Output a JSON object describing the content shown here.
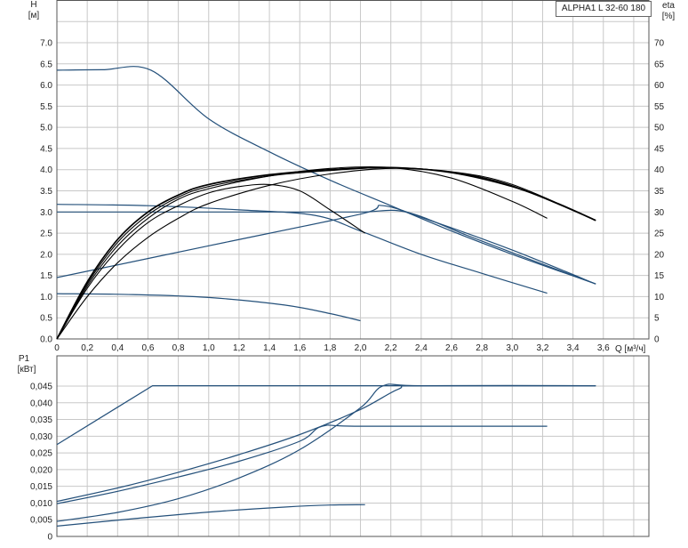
{
  "title": "ALPHA1 L 32-60 180",
  "chart_data": [
    {
      "type": "line",
      "panel": "head-efficiency",
      "xlabel": "Q [м³/ч]",
      "ylabel": "H",
      "ylabel_unit": "[м]",
      "y2label": "eta",
      "y2label_unit": "[%]",
      "xlim": [
        0,
        3.9
      ],
      "ylim": [
        0,
        7.0
      ],
      "y2lim": [
        0,
        70
      ],
      "x_ticks": [
        "0",
        "0,2",
        "0,4",
        "0,6",
        "0,8",
        "1,0",
        "1,2",
        "1,4",
        "1,6",
        "1,8",
        "2,0",
        "2,2",
        "2,4",
        "2,6",
        "2,8",
        "3,0",
        "3,2",
        "3,4",
        "3,6"
      ],
      "y_ticks": [
        "0.0",
        "0.5",
        "1.0",
        "1.5",
        "2.0",
        "2.5",
        "3.0",
        "3.5",
        "4.0",
        "4.5",
        "5.0",
        "5.5",
        "6.0",
        "6.5",
        "7.0"
      ],
      "y2_ticks": [
        "0",
        "5",
        "10",
        "15",
        "20",
        "25",
        "30",
        "35",
        "40",
        "45",
        "50",
        "55",
        "60",
        "65",
        "70"
      ],
      "grid": true,
      "series": [
        {
          "kind": "head",
          "color": "#24507a",
          "x": [
            0,
            0.3,
            0.62,
            1.0,
            1.4,
            1.8,
            2.2,
            2.6,
            3.0,
            3.55
          ],
          "y": [
            6.35,
            6.36,
            6.35,
            5.2,
            4.42,
            3.75,
            3.15,
            2.55,
            2.0,
            1.3
          ]
        },
        {
          "kind": "head",
          "color": "#24507a",
          "x": [
            0,
            0.6,
            1.2,
            1.7,
            2.0,
            2.4,
            2.8,
            3.23
          ],
          "y": [
            3.18,
            3.15,
            3.05,
            2.92,
            2.55,
            2.0,
            1.55,
            1.08
          ]
        },
        {
          "kind": "head",
          "color": "#24507a",
          "x": [
            0,
            0.5,
            1.0,
            1.5,
            2.0,
            2.3,
            2.7,
            3.1,
            3.55
          ],
          "y": [
            3.0,
            3.0,
            3.0,
            3.0,
            3.0,
            3.0,
            2.45,
            1.9,
            1.3
          ]
        },
        {
          "kind": "head",
          "color": "#24507a",
          "x": [
            0,
            1.0,
            2.0,
            2.15,
            2.5,
            3.0,
            3.55
          ],
          "y": [
            1.45,
            2.2,
            2.95,
            3.15,
            2.75,
            2.1,
            1.3
          ]
        },
        {
          "kind": "head",
          "color": "#24507a",
          "x": [
            0,
            0.5,
            1.0,
            1.5,
            1.8,
            2.0
          ],
          "y": [
            1.07,
            1.05,
            0.98,
            0.8,
            0.6,
            0.43
          ]
        },
        {
          "kind": "eta",
          "color": "#000000",
          "x": [
            0,
            0.2,
            0.4,
            0.6,
            0.8,
            1.0,
            1.4,
            1.8,
            2.2,
            2.6,
            3.0,
            3.3,
            3.55
          ],
          "y": [
            0,
            13.5,
            23.5,
            30,
            34,
            36.5,
            38.8,
            40,
            40.5,
            39.3,
            36.0,
            32.0,
            28.0
          ]
        },
        {
          "kind": "eta",
          "color": "#000000",
          "x": [
            0,
            0.2,
            0.4,
            0.6,
            0.8,
            1.0,
            1.4,
            1.8,
            2.2,
            2.6,
            3.0,
            3.55
          ],
          "y": [
            0,
            13.0,
            22.8,
            29.3,
            33.5,
            36.0,
            38.5,
            39.8,
            40.5,
            39.4,
            36.2,
            28.0
          ]
        },
        {
          "kind": "eta",
          "color": "#000000",
          "x": [
            0,
            0.2,
            0.4,
            0.6,
            0.8,
            1.0,
            1.4,
            1.8,
            2.2,
            2.6,
            3.0,
            3.23
          ],
          "y": [
            0,
            12.5,
            22.0,
            28.5,
            33.0,
            35.5,
            38.5,
            40.3,
            40.5,
            38.0,
            32.5,
            28.5
          ]
        },
        {
          "kind": "eta",
          "color": "#000000",
          "x": [
            0,
            0.2,
            0.4,
            0.6,
            0.8,
            1.0,
            1.2,
            1.4,
            1.6,
            1.8,
            2.03
          ],
          "y": [
            0,
            12.0,
            21.0,
            27.5,
            31.5,
            34.5,
            36.0,
            36.5,
            35.0,
            30.5,
            25.0
          ]
        },
        {
          "kind": "eta",
          "color": "#000000",
          "x": [
            0,
            0.2,
            0.4,
            0.6,
            0.8,
            1.0,
            1.4,
            1.8,
            2.2,
            2.6,
            3.0,
            3.55
          ],
          "y": [
            0,
            10.0,
            18.0,
            24.0,
            28.5,
            32.0,
            36.3,
            39.0,
            40.3,
            39.5,
            36.5,
            28.0
          ]
        }
      ]
    },
    {
      "type": "line",
      "panel": "power",
      "ylabel": "P1",
      "ylabel_unit": "[кВт]",
      "xlim": [
        0,
        3.9
      ],
      "ylim": [
        0,
        0.045
      ],
      "y_ticks": [
        "0",
        "0,005",
        "0,010",
        "0,015",
        "0,020",
        "0,025",
        "0,030",
        "0,035",
        "0,040",
        "0,045"
      ],
      "grid": true,
      "series": [
        {
          "color": "#24507a",
          "x": [
            0,
            0.63,
            3.55
          ],
          "y": [
            0.0275,
            0.0451,
            0.0451
          ]
        },
        {
          "color": "#24507a",
          "x": [
            0,
            0.4,
            0.8,
            1.2,
            1.6,
            2.0,
            2.25,
            2.4,
            3.55
          ],
          "y": [
            0.0105,
            0.0145,
            0.0192,
            0.0245,
            0.0305,
            0.038,
            0.0441,
            0.0451,
            0.0451
          ]
        },
        {
          "color": "#24507a",
          "x": [
            0,
            0.4,
            0.8,
            1.2,
            1.6,
            1.75,
            2.0,
            3.23
          ],
          "y": [
            0.0098,
            0.0135,
            0.0178,
            0.0225,
            0.0285,
            0.033,
            0.033,
            0.033
          ]
        },
        {
          "color": "#24507a",
          "x": [
            0,
            0.4,
            0.8,
            1.2,
            1.6,
            2.0,
            2.15,
            2.4,
            3.55
          ],
          "y": [
            0.0045,
            0.0072,
            0.0113,
            0.0175,
            0.026,
            0.0385,
            0.0451,
            0.0451,
            0.0451
          ]
        },
        {
          "color": "#24507a",
          "x": [
            0,
            0.5,
            1.0,
            1.5,
            1.8,
            2.03
          ],
          "y": [
            0.0031,
            0.0053,
            0.0073,
            0.0088,
            0.0094,
            0.0095
          ]
        }
      ]
    }
  ]
}
